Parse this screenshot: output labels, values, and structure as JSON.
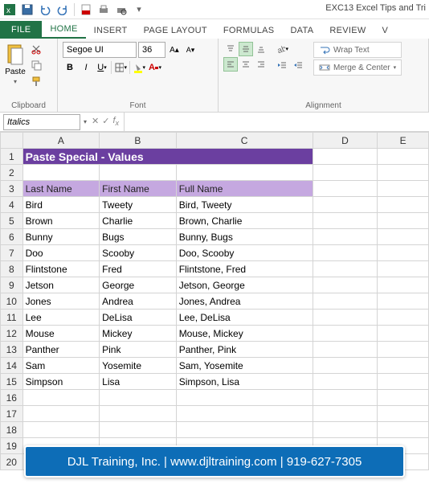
{
  "window": {
    "title": "EXC13 Excel Tips and Tri"
  },
  "tabs": {
    "file": "FILE",
    "items": [
      "HOME",
      "INSERT",
      "PAGE LAYOUT",
      "FORMULAS",
      "DATA",
      "REVIEW",
      "V"
    ],
    "active": "HOME"
  },
  "ribbon": {
    "clipboard": {
      "paste": "Paste",
      "label": "Clipboard"
    },
    "font": {
      "name": "Segoe UI",
      "size": "36",
      "label": "Font"
    },
    "alignment": {
      "wrap": "Wrap Text",
      "merge": "Merge & Center",
      "label": "Alignment"
    }
  },
  "namebox": {
    "value": "Italics"
  },
  "columns": [
    "A",
    "B",
    "C",
    "D",
    "E"
  ],
  "sheet": {
    "title": "Paste Special - Values",
    "headers": [
      "Last Name",
      "First Name",
      "Full Name"
    ],
    "rows": [
      {
        "n": 4,
        "a": "Bird",
        "b": "Tweety",
        "c": "Bird, Tweety"
      },
      {
        "n": 5,
        "a": "Brown",
        "b": "Charlie",
        "c": "Brown, Charlie"
      },
      {
        "n": 6,
        "a": "Bunny",
        "b": "Bugs",
        "c": "Bunny, Bugs"
      },
      {
        "n": 7,
        "a": "Doo",
        "b": "Scooby",
        "c": "Doo, Scooby"
      },
      {
        "n": 8,
        "a": "Flintstone",
        "b": "Fred",
        "c": "Flintstone, Fred"
      },
      {
        "n": 9,
        "a": "Jetson",
        "b": "George",
        "c": "Jetson, George"
      },
      {
        "n": 10,
        "a": "Jones",
        "b": "Andrea",
        "c": "Jones, Andrea"
      },
      {
        "n": 11,
        "a": "Lee",
        "b": "DeLisa",
        "c": "Lee, DeLisa"
      },
      {
        "n": 12,
        "a": "Mouse",
        "b": "Mickey",
        "c": "Mouse, Mickey"
      },
      {
        "n": 13,
        "a": "Panther",
        "b": "Pink",
        "c": "Panther, Pink"
      },
      {
        "n": 14,
        "a": "Sam",
        "b": "Yosemite",
        "c": "Sam, Yosemite"
      },
      {
        "n": 15,
        "a": "Simpson",
        "b": "Lisa",
        "c": "Simpson, Lisa"
      }
    ],
    "empty": [
      16,
      17,
      18,
      19,
      20
    ]
  },
  "banner": "DJL Training, Inc. | www.djltraining.com | 919-627-7305"
}
